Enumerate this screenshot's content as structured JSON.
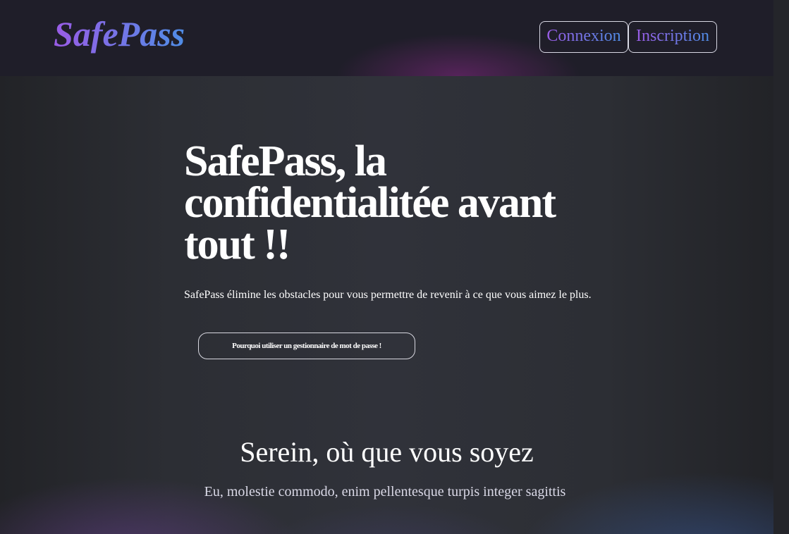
{
  "header": {
    "logo": "SafePass",
    "nav": [
      {
        "label": "Connexion"
      },
      {
        "label": "Inscription"
      }
    ]
  },
  "hero": {
    "title": "SafePass, la confidentialitée avant tout !!",
    "subtitle": "SafePass élimine les obstacles pour vous permettre de revenir à ce que vous aimez le plus.",
    "cta_label": "Pourquoi utiliser un gestionnaire de mot de passe !"
  },
  "section": {
    "title": "Serein, où que vous soyez",
    "subtitle": "Eu, molestie commodo, enim pellentesque turpis integer sagittis"
  },
  "colors": {
    "accent_gradient_start": "#9a5ce6",
    "accent_gradient_end": "#4f8de6",
    "header_bg": "#1f1e29",
    "page_bg": "#2c2e34"
  }
}
